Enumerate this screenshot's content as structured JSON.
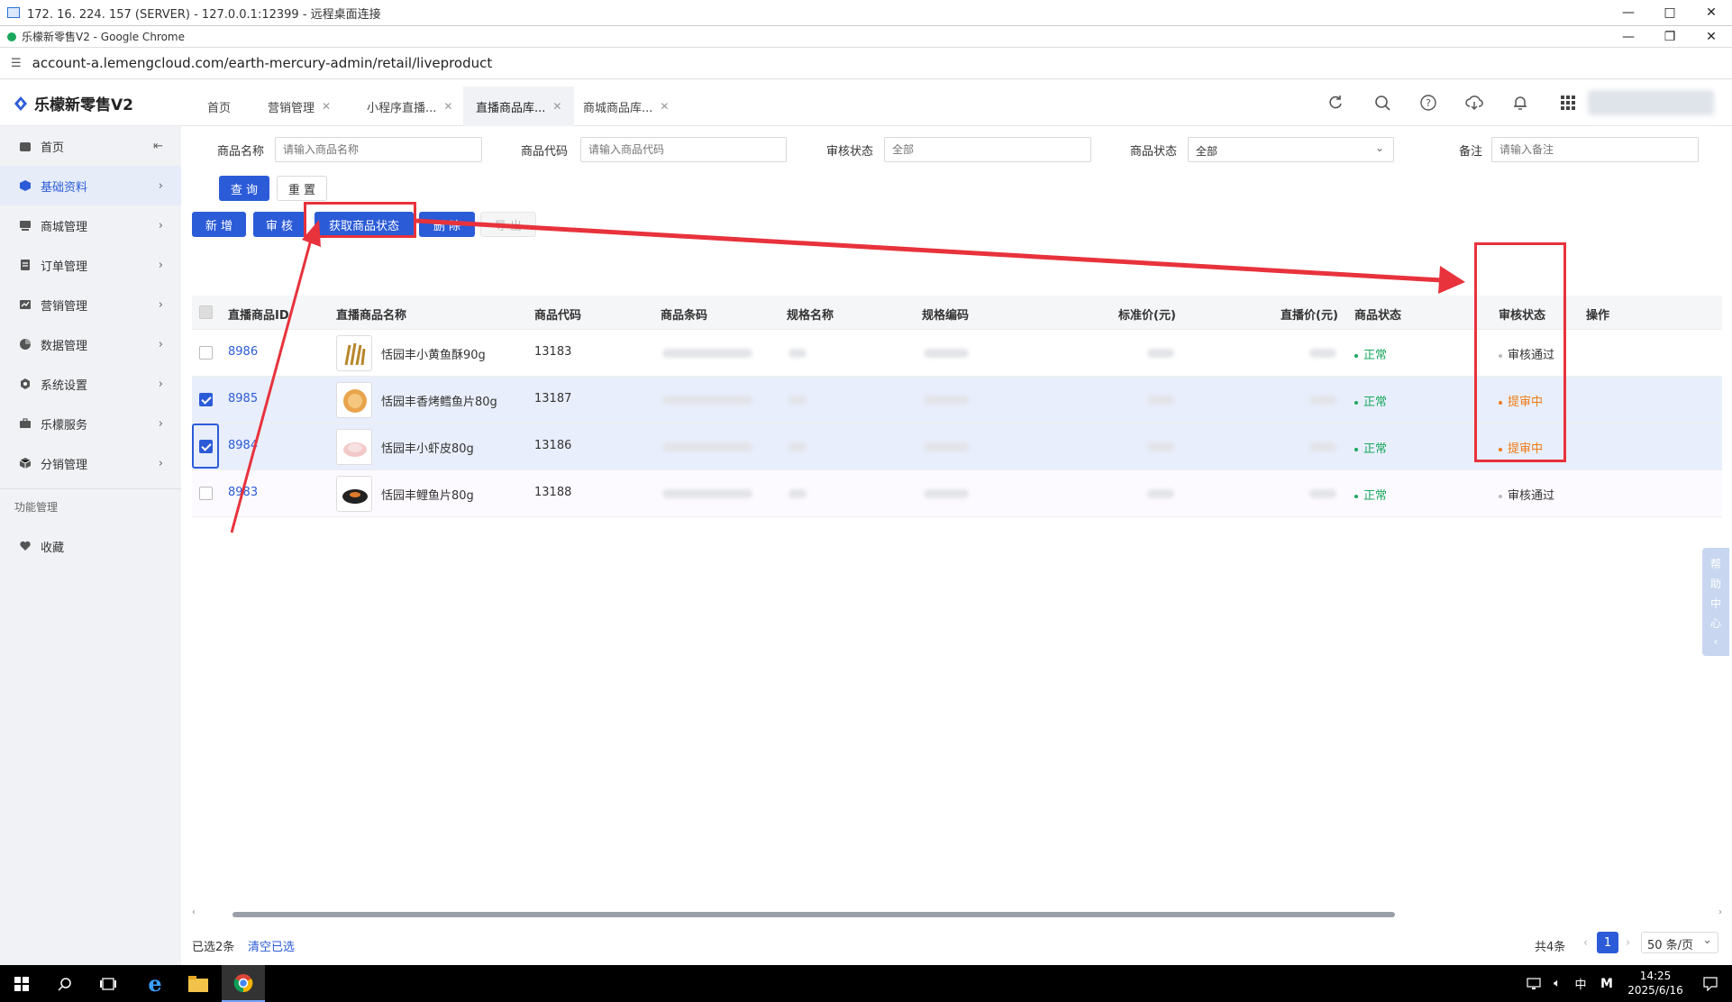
{
  "rdp": {
    "title": "172. 16. 224. 157 (SERVER) - 127.0.0.1:12399 - 远程桌面连接"
  },
  "browser": {
    "title": "乐檬新零售V2 - Google Chrome",
    "url": "account-a.lemengcloud.com/earth-mercury-admin/retail/liveproduct"
  },
  "app": {
    "logo": "乐檬新零售V2",
    "tabs": [
      {
        "label": "首页"
      },
      {
        "label": "营销管理"
      },
      {
        "label": "小程序直播..."
      },
      {
        "label": "直播商品库..."
      },
      {
        "label": "商城商品库..."
      }
    ]
  },
  "sidebar": {
    "items": [
      {
        "label": "首页"
      },
      {
        "label": "基础资料"
      },
      {
        "label": "商城管理"
      },
      {
        "label": "订单管理"
      },
      {
        "label": "营销管理"
      },
      {
        "label": "数据管理"
      },
      {
        "label": "系统设置"
      },
      {
        "label": "乐檬服务"
      },
      {
        "label": "分销管理"
      }
    ],
    "section": "功能管理",
    "favorites": "收藏"
  },
  "filters": {
    "name_label": "商品名称",
    "name_placeholder": "请输入商品名称",
    "code_label": "商品代码",
    "code_placeholder": "请输入商品代码",
    "audit_label": "审核状态",
    "audit_placeholder": "全部",
    "status_label": "商品状态",
    "status_value": "全部",
    "remark_label": "备注",
    "remark_placeholder": "请输入备注",
    "query": "查 询",
    "reset": "重 置"
  },
  "toolbar": {
    "add": "新 增",
    "audit": "审 核",
    "fetch_status": "获取商品状态",
    "delete": "删 除",
    "export": "导 出"
  },
  "table": {
    "headers": [
      "直播商品ID",
      "直播商品名称",
      "商品代码",
      "商品条码",
      "规格名称",
      "规格编码",
      "标准价(元)",
      "直播价(元)",
      "商品状态",
      "审核状态",
      "操作"
    ],
    "rows": [
      {
        "id": "8986",
        "name": "恬园丰小黄鱼酥90g",
        "code": "13183",
        "status": "正常",
        "audit": "审核通过",
        "checked": false
      },
      {
        "id": "8985",
        "name": "恬园丰香烤鳕鱼片80g",
        "code": "13187",
        "status": "正常",
        "audit": "提审中",
        "checked": true
      },
      {
        "id": "8984",
        "name": "恬园丰小虾皮80g",
        "code": "13186",
        "status": "正常",
        "audit": "提审中",
        "checked": true
      },
      {
        "id": "8983",
        "name": "恬园丰鲤鱼片80g",
        "code": "13188",
        "status": "正常",
        "audit": "审核通过",
        "checked": false
      }
    ]
  },
  "footer": {
    "selected": "已选2条",
    "clear": "清空已选",
    "total": "共4条",
    "page": "1",
    "per_page": "50 条/页"
  },
  "help": [
    "帮",
    "助",
    "中",
    "心"
  ],
  "taskbar": {
    "time": "14:25",
    "date": "2025/6/16",
    "ime": "中",
    "ime2": "M"
  },
  "colors": {
    "primary": "#2b5bd7",
    "success": "#1aa85f",
    "warning": "#f07b16",
    "annotation": "#e8323c"
  }
}
